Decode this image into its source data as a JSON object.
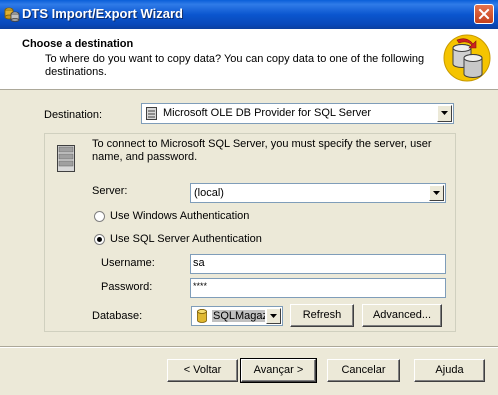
{
  "window": {
    "title": "DTS Import/Export Wizard"
  },
  "header": {
    "title": "Choose a destination",
    "description": "To where do you want to copy data?  You can copy data to one of the following destinations."
  },
  "destination": {
    "label": "Destination:",
    "value": "Microsoft OLE DB Provider for SQL Server"
  },
  "connection": {
    "info": "To connect to Microsoft SQL Server, you must specify the server, user name, and password.",
    "server_label": "Server:",
    "server_value": "(local)",
    "auth_options": [
      {
        "label": "Use Windows Authentication",
        "selected": false
      },
      {
        "label": "Use SQL Server Authentication",
        "selected": true
      }
    ],
    "username_label": "Username:",
    "username_value": "sa",
    "password_label": "Password:",
    "password_value": "****",
    "database_label": "Database:",
    "database_value": "SQLMagazine",
    "refresh_label": "Refresh",
    "advanced_label": "Advanced..."
  },
  "footer": {
    "back_label": "< Voltar",
    "next_label": "Avançar >",
    "cancel_label": "Cancelar",
    "help_label": "Ajuda"
  },
  "colors": {
    "titlebar": "#0b56cf",
    "dialog_bg": "#ece9d8",
    "close_button": "#c3401c"
  }
}
